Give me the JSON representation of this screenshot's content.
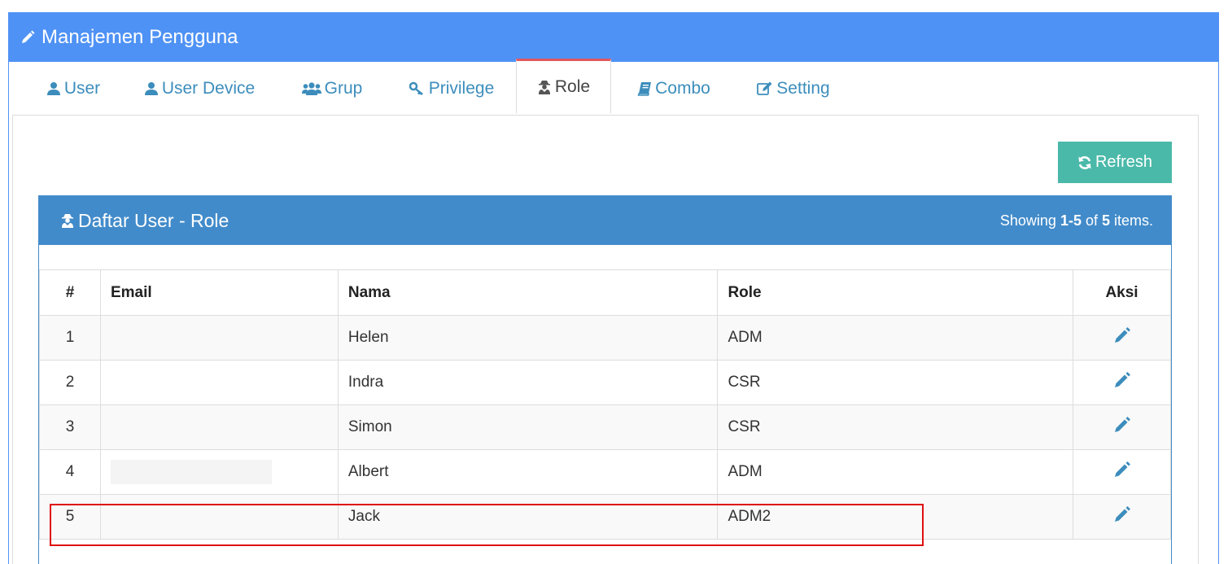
{
  "header": {
    "title": "Manajemen Pengguna",
    "icon": "pencil-icon"
  },
  "tabs": [
    {
      "label": "User",
      "icon": "user-icon"
    },
    {
      "label": " User Device",
      "icon": "user-icon"
    },
    {
      "label": "Grup",
      "icon": "users-icon"
    },
    {
      "label": "Privilege",
      "icon": "key-icon"
    },
    {
      "label": "Role",
      "icon": "user-secret-icon",
      "active": true
    },
    {
      "label": "Combo",
      "icon": "book-icon"
    },
    {
      "label": "Setting",
      "icon": "edit-icon"
    }
  ],
  "toolbar": {
    "refresh_label": "Refresh"
  },
  "panel": {
    "title": "Daftar User - Role",
    "summary": {
      "prefix": "Showing ",
      "range": "1-5",
      "middle": " of ",
      "total": "5",
      "suffix": " items."
    }
  },
  "table": {
    "columns": [
      "#",
      "Email",
      "Nama",
      "Role",
      "Aksi"
    ],
    "rows": [
      {
        "no": "1",
        "email": "",
        "nama": "Helen",
        "role": "ADM"
      },
      {
        "no": "2",
        "email": "",
        "nama": "Indra",
        "role": "CSR"
      },
      {
        "no": "3",
        "email": "",
        "nama": "Simon",
        "role": "CSR"
      },
      {
        "no": "4",
        "email": "",
        "nama": "Albert",
        "role": "ADM"
      },
      {
        "no": "5",
        "email": "",
        "nama": "Jack",
        "role": "ADM2"
      }
    ]
  },
  "colors": {
    "header_bg": "#4f92f5",
    "panel_head_bg": "#428bca",
    "refresh_bg": "#4bb9a9",
    "active_tab_border": "#e0585f",
    "link": "#3c8dbc",
    "highlight": "#e01010"
  }
}
